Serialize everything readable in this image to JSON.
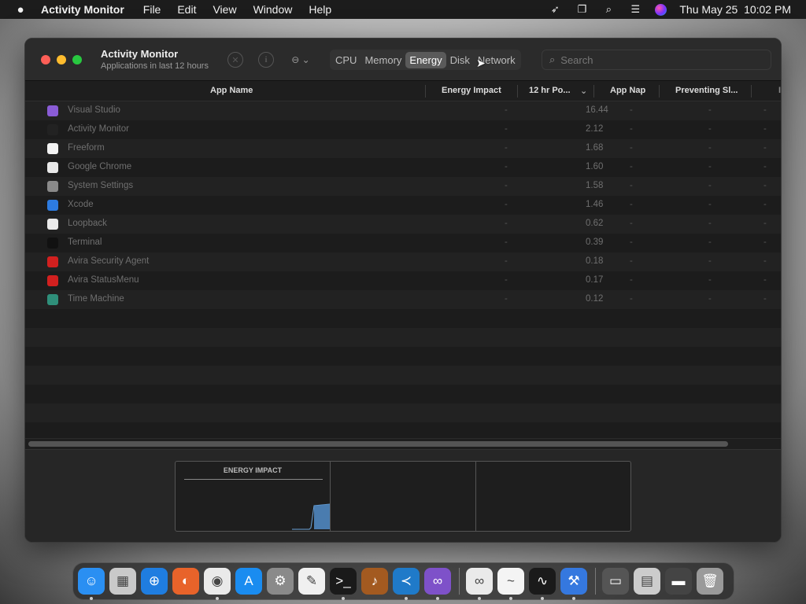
{
  "menubar": {
    "apple": "",
    "app": "Activity Monitor",
    "items": [
      "File",
      "Edit",
      "View",
      "Window",
      "Help"
    ],
    "clock": "Thu May 25  10:02 PM"
  },
  "window": {
    "title": "Activity Monitor",
    "subtitle": "Applications in last 12 hours",
    "tabs": [
      "CPU",
      "Memory",
      "Energy",
      "Disk",
      "Network"
    ],
    "active_tab": "Energy",
    "search_placeholder": "Search"
  },
  "table": {
    "headers": {
      "app_name": "App Name",
      "energy_impact": "Energy Impact",
      "twelve_hr": "12 hr Po...",
      "app_nap": "App Nap",
      "preventing": "Preventing Sl...",
      "extra": "I"
    },
    "rows": [
      {
        "name": "Visual Studio",
        "energy": "-",
        "hr12": "16.44",
        "app_nap": "-",
        "preventing": "-",
        "extra": "-",
        "icon_color": "#8a5cd6",
        "icon": "visual-studio-icon"
      },
      {
        "name": "Activity Monitor",
        "energy": "-",
        "hr12": "2.12",
        "app_nap": "-",
        "preventing": "-",
        "extra": "-",
        "icon_color": "#222",
        "icon": "activity-monitor-icon"
      },
      {
        "name": "Freeform",
        "energy": "-",
        "hr12": "1.68",
        "app_nap": "-",
        "preventing": "-",
        "extra": "-",
        "icon_color": "#f2f2f2",
        "icon": "freeform-icon"
      },
      {
        "name": "Google Chrome",
        "energy": "-",
        "hr12": "1.60",
        "app_nap": "-",
        "preventing": "-",
        "extra": "-",
        "icon_color": "#e8e8e8",
        "icon": "chrome-icon"
      },
      {
        "name": "System Settings",
        "energy": "-",
        "hr12": "1.58",
        "app_nap": "-",
        "preventing": "-",
        "extra": "-",
        "icon_color": "#8a8a8a",
        "icon": "settings-icon"
      },
      {
        "name": "Xcode",
        "energy": "-",
        "hr12": "1.46",
        "app_nap": "-",
        "preventing": "-",
        "extra": "-",
        "icon_color": "#2d7be0",
        "icon": "xcode-icon"
      },
      {
        "name": "Loopback",
        "energy": "-",
        "hr12": "0.62",
        "app_nap": "-",
        "preventing": "-",
        "extra": "-",
        "icon_color": "#e9e9e9",
        "icon": "loopback-icon"
      },
      {
        "name": "Terminal",
        "energy": "-",
        "hr12": "0.39",
        "app_nap": "-",
        "preventing": "-",
        "extra": "-",
        "icon_color": "#111",
        "icon": "terminal-icon"
      },
      {
        "name": "Avira Security Agent",
        "energy": "-",
        "hr12": "0.18",
        "app_nap": "-",
        "preventing": "-",
        "extra": "-",
        "icon_color": "#d2201f",
        "icon": "avira-icon"
      },
      {
        "name": "Avira StatusMenu",
        "energy": "-",
        "hr12": "0.17",
        "app_nap": "-",
        "preventing": "-",
        "extra": "-",
        "icon_color": "#d2201f",
        "icon": "avira-icon"
      },
      {
        "name": "Time Machine",
        "energy": "-",
        "hr12": "0.12",
        "app_nap": "-",
        "preventing": "-",
        "extra": "-",
        "icon_color": "#2f8f7a",
        "icon": "time-machine-icon"
      }
    ]
  },
  "graph": {
    "title": "ENERGY IMPACT"
  },
  "dock": {
    "apps": [
      {
        "name": "finder-icon",
        "color": "#2a8ff2",
        "glyph": "☺",
        "running": true
      },
      {
        "name": "launchpad-icon",
        "color": "#c9c9c9",
        "glyph": "▦",
        "running": false
      },
      {
        "name": "safari-icon",
        "color": "#1f7de0",
        "glyph": "⊕",
        "running": false
      },
      {
        "name": "firefox-icon",
        "color": "#e8632a",
        "glyph": "◐",
        "running": false
      },
      {
        "name": "chrome-icon",
        "color": "#eaeaea",
        "glyph": "◉",
        "running": true
      },
      {
        "name": "app-store-icon",
        "color": "#1a8cf0",
        "glyph": "A",
        "running": false
      },
      {
        "name": "system-settings-icon",
        "color": "#8a8a8a",
        "glyph": "⚙",
        "running": false
      },
      {
        "name": "textedit-icon",
        "color": "#f0f0f0",
        "glyph": "✎",
        "running": false
      },
      {
        "name": "terminal-icon",
        "color": "#1a1a1a",
        "glyph": ">_",
        "running": true
      },
      {
        "name": "garageband-icon",
        "color": "#a35a20",
        "glyph": "♪",
        "running": false
      },
      {
        "name": "vscode-icon",
        "color": "#1f7ac9",
        "glyph": "≺",
        "running": true
      },
      {
        "name": "visual-studio-icon",
        "color": "#7e51c9",
        "glyph": "∞",
        "running": true
      }
    ],
    "apps2": [
      {
        "name": "loopback-icon",
        "color": "#eaeaea",
        "glyph": "∞",
        "running": true
      },
      {
        "name": "freeform-icon",
        "color": "#f4f4f4",
        "glyph": "~",
        "running": true
      },
      {
        "name": "activity-monitor-icon",
        "color": "#1a1a1a",
        "glyph": "∿",
        "running": true
      },
      {
        "name": "xcode-icon",
        "color": "#3578df",
        "glyph": "⚒",
        "running": true
      }
    ],
    "apps3": [
      {
        "name": "window-thumbnail-icon",
        "color": "#555555",
        "glyph": "▭",
        "running": false
      },
      {
        "name": "downloads-icon",
        "color": "#cccccc",
        "glyph": "▤",
        "running": false
      },
      {
        "name": "document-icon",
        "color": "#444444",
        "glyph": "▬",
        "running": false
      },
      {
        "name": "trash-icon",
        "color": "#9a9a9a",
        "glyph": "🗑",
        "running": false
      }
    ]
  }
}
